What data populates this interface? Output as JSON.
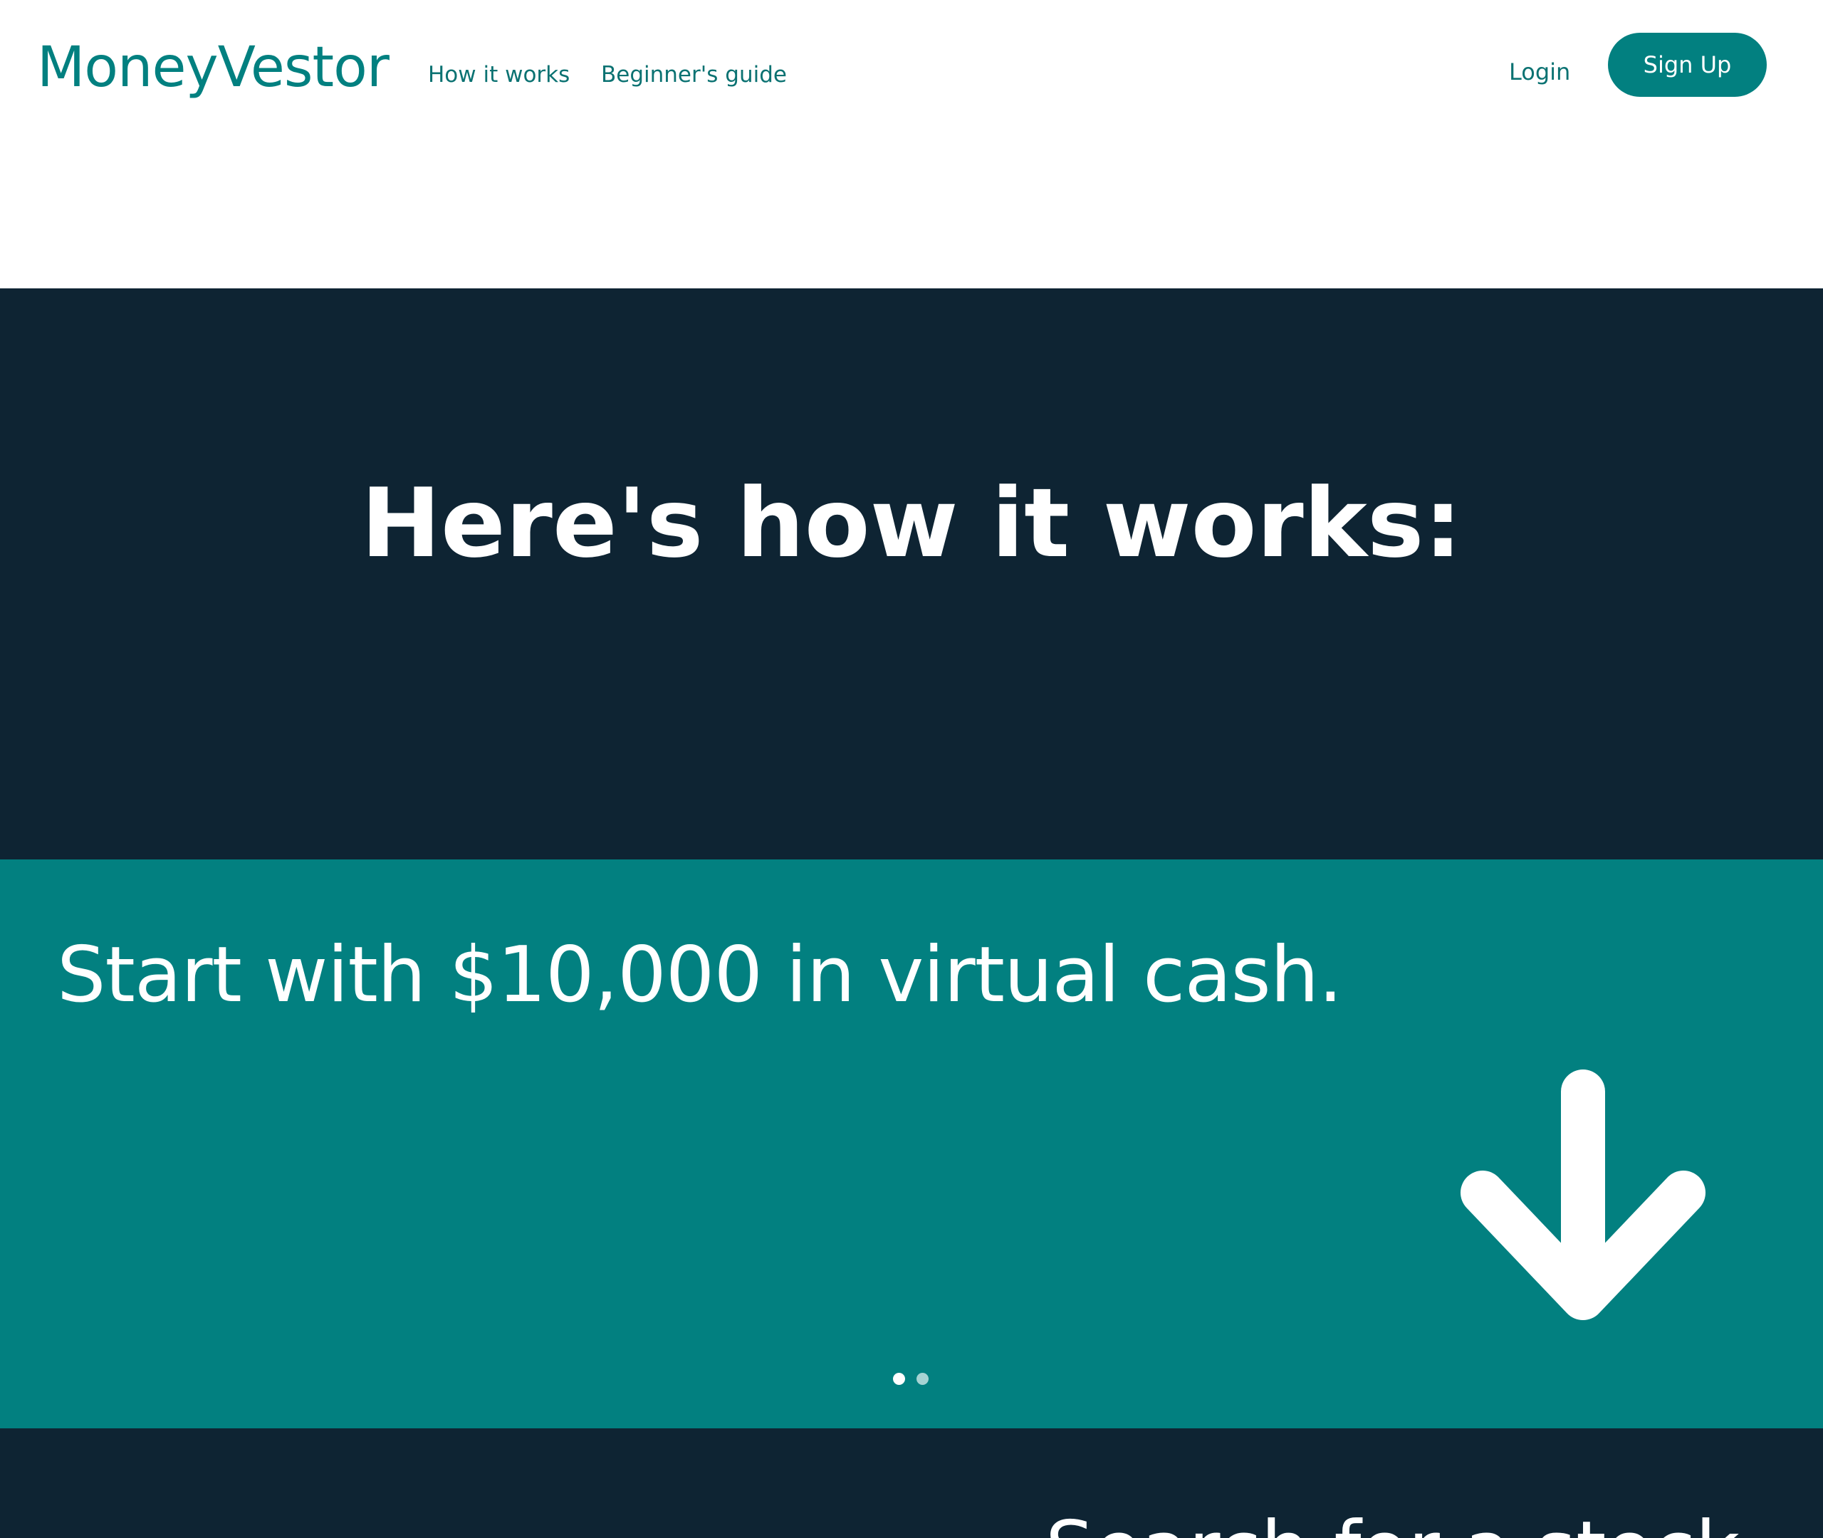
{
  "header": {
    "logo": "MoneyVestor",
    "nav": {
      "how_it_works": "How it works",
      "beginners_guide": "Beginner's guide"
    },
    "login": "Login",
    "signup": "Sign Up"
  },
  "hero": {
    "title": "Here's how it works:"
  },
  "step": {
    "text": "Start with $10,000 in virtual cash.",
    "icon": "arrow-down-icon",
    "slides_total": 2,
    "slide_active": 1
  },
  "next_section": {
    "text": "Search for a stock"
  },
  "colors": {
    "accent": "#028080",
    "dark": "#0e2433",
    "white": "#ffffff"
  }
}
